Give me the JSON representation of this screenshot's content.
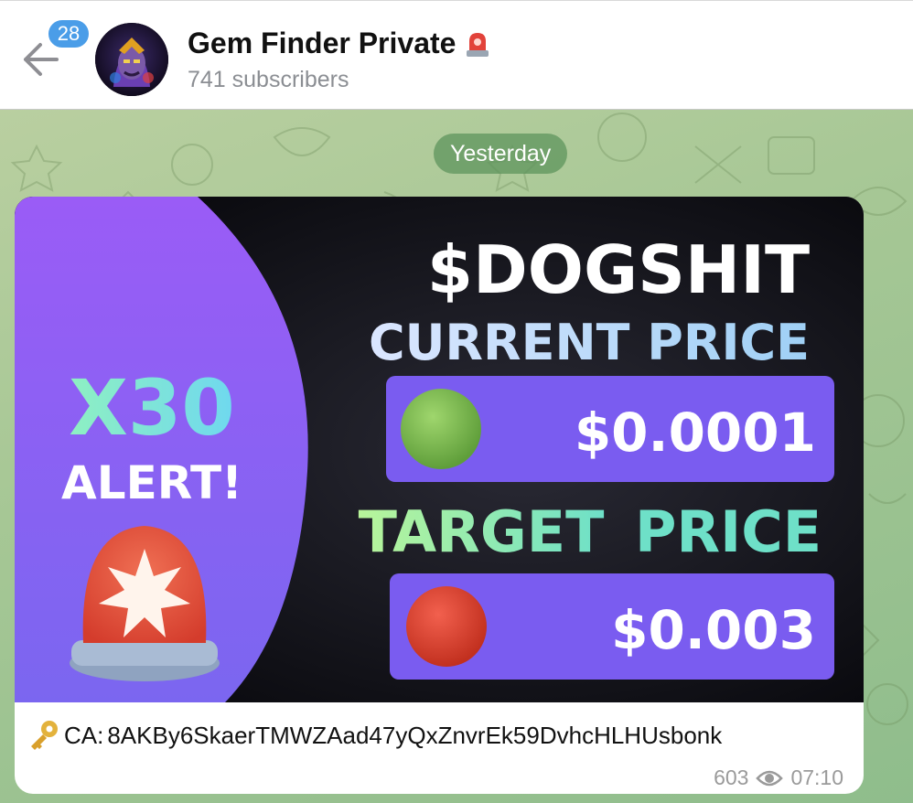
{
  "header": {
    "back_badge": "28",
    "channel_name": "Gem Finder Private",
    "subscribers": "741 subscribers"
  },
  "chat": {
    "date_label": "Yesterday"
  },
  "message": {
    "image": {
      "ticker": "$DOGSHIT",
      "current_price_label": "CURRENT PRICE",
      "current_price_value": "$0.0001",
      "target_price_label_1": "TARGET",
      "target_price_label_2": "PRICE",
      "alert_multiplier": "X30",
      "alert_word": "ALERT!"
    },
    "caption_prefix": "CA: ",
    "caption_address": "8AKBy6SkaerTMWZAad47yQxZnvrEk59DvhcHLHUsbonk",
    "views": "603",
    "time": "07:10"
  },
  "icons": {
    "back": "arrow-left-icon",
    "siren": "rotating-light-icon",
    "key": "key-icon",
    "eye": "eye-icon"
  },
  "colors": {
    "accent": "#4a9de8",
    "image_purple": "#8a5cf6",
    "ticker_green": "#7ee3a3"
  }
}
